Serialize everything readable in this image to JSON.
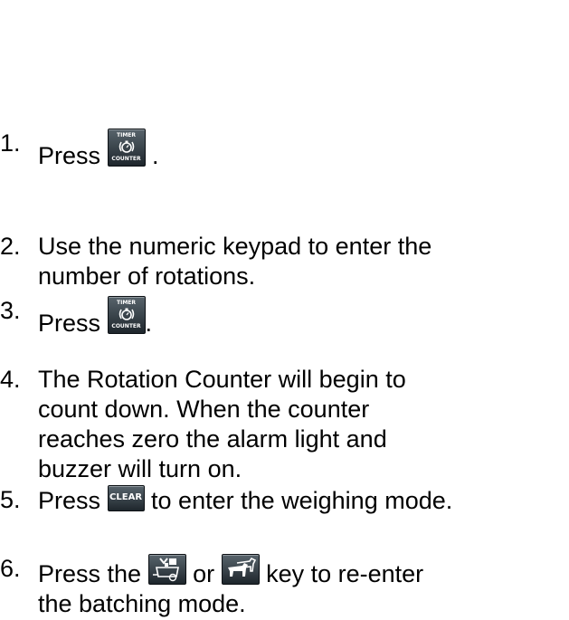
{
  "steps": [
    {
      "number": "1.",
      "before": "Press ",
      "after": " ."
    },
    {
      "number": "2.",
      "lines": [
        "Use the numeric keypad to enter the",
        "number of rotations."
      ]
    },
    {
      "number": "3.",
      "before": "Press ",
      "after": "."
    },
    {
      "number": "4.",
      "lines": [
        "The Rotation Counter will begin to",
        "count down.  When the counter",
        "reaches zero the alarm light and",
        "buzzer will turn on."
      ]
    },
    {
      "number": "5.",
      "before": "Press ",
      "after": " to enter the weighing mode."
    },
    {
      "number": "6.",
      "before": "Press the ",
      "middle": " or ",
      "after": " key to re-enter",
      "line2": "the batching mode."
    }
  ],
  "keys": {
    "timer_counter": {
      "top": "TIMER",
      "bottom": "COUNTER",
      "icon": "stopwatch-icon"
    },
    "clear": {
      "label": "CLEAR"
    },
    "batch": {
      "icon": "feed-wagon-icon"
    },
    "herd": {
      "icon": "cattle-icon"
    }
  },
  "colors": {
    "key_face": "#2a3238",
    "key_text": "#ffffff",
    "text": "#000000"
  }
}
